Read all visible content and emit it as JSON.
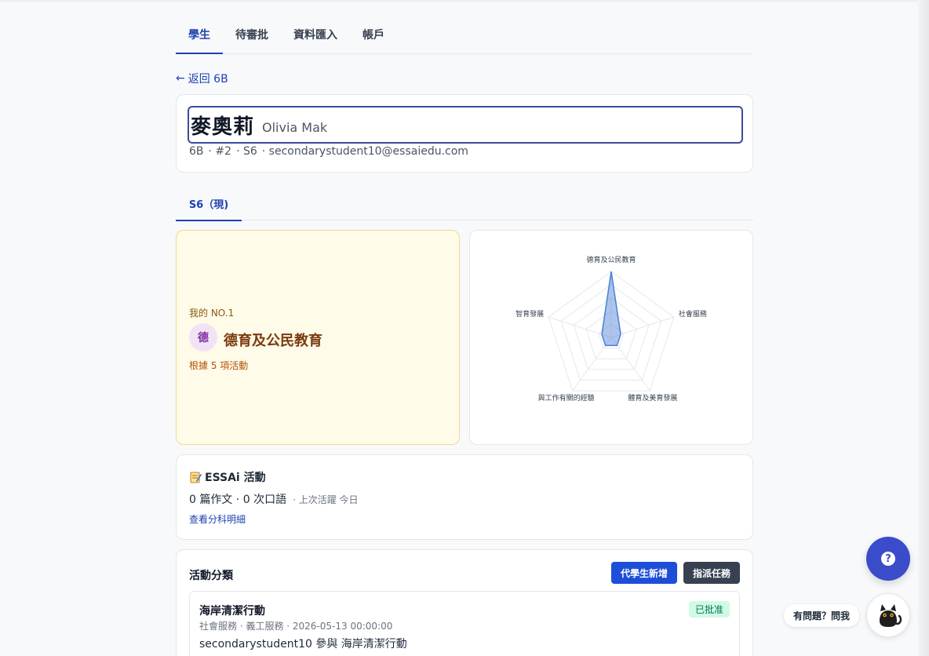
{
  "nav": {
    "tabs": [
      {
        "label": "學生",
        "active": true
      },
      {
        "label": "待審批"
      },
      {
        "label": "資料匯入"
      },
      {
        "label": "帳戶"
      }
    ]
  },
  "back": {
    "arrow": "←",
    "label": "返回 6B"
  },
  "student": {
    "name_zh": "麥奧莉",
    "name_en": "Olivia Mak",
    "class": "6B",
    "number": "· #2",
    "form": "· S6",
    "email": "· secondarystudent10@essaiedu.com"
  },
  "year_tab": {
    "label": "S6（現)"
  },
  "no1": {
    "label": "我的 NO.1",
    "badge": "德",
    "title": "德育及公民教育",
    "sub": "根據 5 項活動"
  },
  "radar": {
    "axes": [
      "德育及公民教育",
      "社會服務",
      "體育及美育發展",
      "與工作有關的經驗",
      "智育發展"
    ],
    "values": [
      1.0,
      0.15,
      0.15,
      0.15,
      0.15
    ],
    "levels": 5,
    "fill_color": "#4a7fd8"
  },
  "essai": {
    "icon": "memo-icon",
    "title": "ESSAi 活動",
    "stats": "0 篇作文 · 0 次口語",
    "last_active": "· 上次活躍 今日",
    "link": "查看分科明細"
  },
  "activities": {
    "title": "活動分類",
    "add_button": "代學生新增",
    "assign_button": "指派任務",
    "items": [
      {
        "name": "海岸清潔行動",
        "status": "已批准",
        "meta": "社會服務 · 義工服務 · 2026-05-13 00:00:00",
        "desc": "secondarystudent10 參與 海岸清潔行動"
      }
    ]
  },
  "help": {
    "icon": "question-icon",
    "ask_label": "有問題？問我",
    "assistant_icon": "cat-icon"
  },
  "colors": {
    "accent": "#1e40af",
    "primary_button": "#1d4ed8",
    "dark_button": "#374151",
    "approved": "#047857"
  }
}
